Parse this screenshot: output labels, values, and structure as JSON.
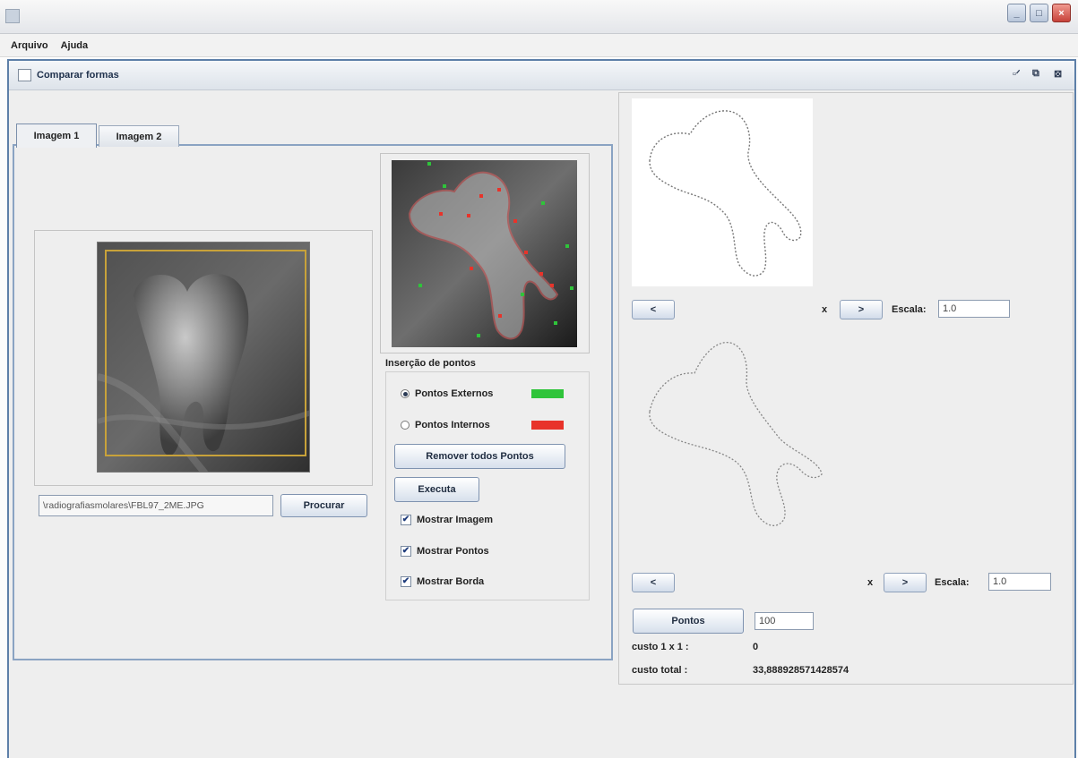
{
  "window": {
    "title": "",
    "controls": {
      "minimize": "_",
      "maximize": "□",
      "close": "×"
    }
  },
  "menubar": {
    "items": [
      {
        "label": "Arquivo",
        "mnemonic": "A"
      },
      {
        "label": "Ajuda",
        "mnemonic": "j"
      }
    ]
  },
  "internal_frame": {
    "title": "Comparar formas",
    "controls": {
      "iconify": "▫ᐟ",
      "maximize": "⧉",
      "close": "⊠"
    }
  },
  "tabs": [
    {
      "label": "Imagem 1",
      "selected": true
    },
    {
      "label": "Imagem 2",
      "selected": false
    }
  ],
  "left": {
    "file_path": "\\radiografiasmolares\\FBL97_2ME.JPG",
    "browse_button": "Procurar"
  },
  "point_insertion": {
    "title": "Inserção de pontos",
    "options": [
      {
        "label": "Pontos Externos",
        "selected": true,
        "color": "#2fc43a"
      },
      {
        "label": "Pontos Internos",
        "selected": false,
        "color": "#e8332a"
      }
    ],
    "remove_button": "Remover todos Pontos",
    "execute_button": "Executa",
    "checkboxes": [
      {
        "label": "Mostrar Imagem",
        "checked": true
      },
      {
        "label": "Mostrar Pontos",
        "checked": true
      },
      {
        "label": "Mostrar Borda",
        "checked": true
      }
    ]
  },
  "right": {
    "top": {
      "prev_label": "<",
      "x_label": "x",
      "next_label": ">",
      "scale_label": "Escala:",
      "scale_value": "1.0"
    },
    "bottom": {
      "prev_label": "<",
      "x_label": "x",
      "next_label": ">",
      "scale_label": "Escala:",
      "scale_value": "1.0"
    },
    "points_button": "Pontos",
    "points_value": "100",
    "cost_1x1_label": "custo 1 x 1 :",
    "cost_1x1_value": "0",
    "cost_total_label": "custo total :",
    "cost_total_value": "33,888928571428574"
  },
  "colors": {
    "frame_border": "#5d7fa8",
    "contour": "#e06060",
    "external_point": "#2fc43a",
    "internal_point": "#e8332a"
  }
}
